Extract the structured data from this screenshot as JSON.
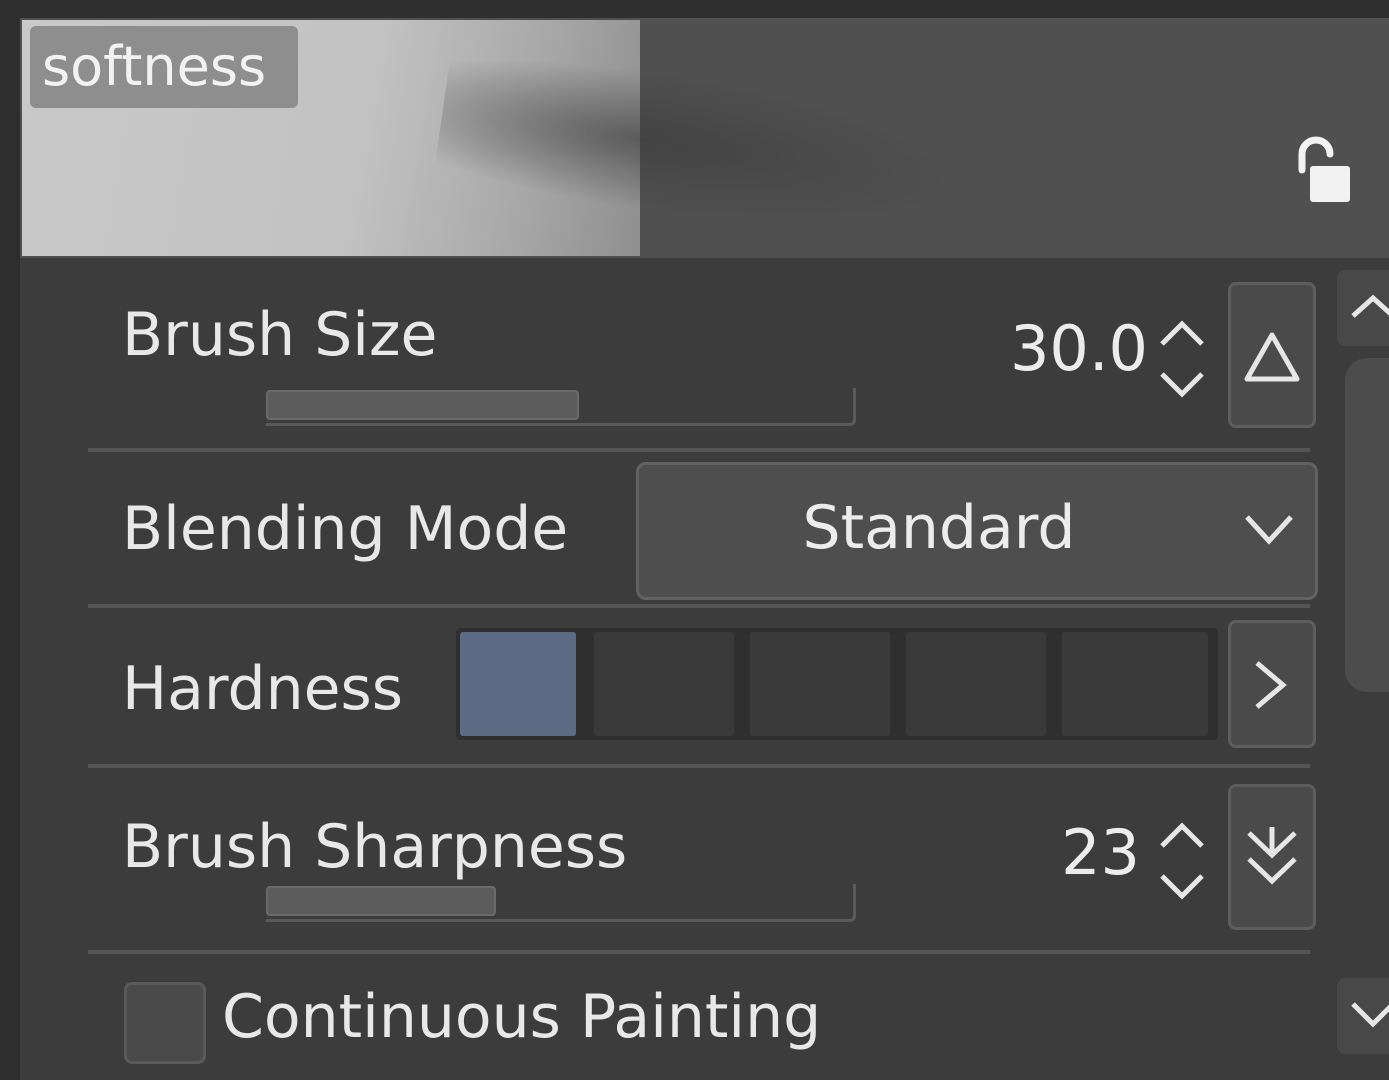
{
  "preview": {
    "label": "softness",
    "lock_icon": "unlock-icon"
  },
  "brush_size": {
    "label": "Brush Size",
    "value": "30.0",
    "slider_fraction": 0.53
  },
  "blending_mode": {
    "label": "Blending Mode",
    "selected": "Standard"
  },
  "hardness": {
    "label": "Hardness",
    "swatch_count": 5,
    "selected_index": 0
  },
  "brush_sharpness": {
    "label": "Brush Sharpness",
    "value": "23",
    "slider_fraction": 0.39
  },
  "continuous_painting": {
    "label": "Continuous Painting",
    "checked": false
  },
  "colors": {
    "panel_bg": "#3c3c3c",
    "accent_swatch": "#5e6b85"
  }
}
